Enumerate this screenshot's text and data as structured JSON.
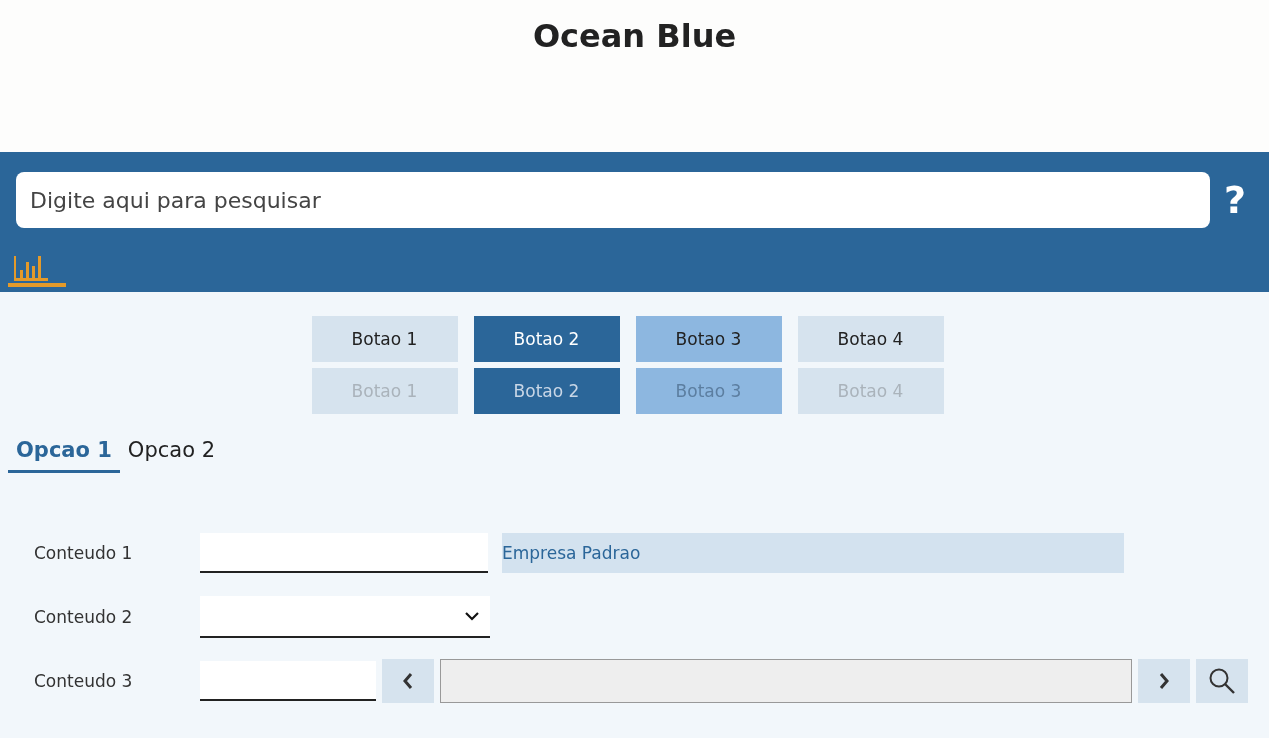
{
  "title": "Ocean Blue",
  "search": {
    "placeholder": "Digite aqui para pesquisar"
  },
  "help": "?",
  "button_rows": [
    [
      {
        "label": "Botao 1",
        "kind": "default",
        "disabled": false
      },
      {
        "label": "Botao 2",
        "kind": "primary",
        "disabled": false
      },
      {
        "label": "Botao 3",
        "kind": "secondary",
        "disabled": false
      },
      {
        "label": "Botao 4",
        "kind": "default",
        "disabled": false
      }
    ],
    [
      {
        "label": "Botao 1",
        "kind": "default",
        "disabled": true
      },
      {
        "label": "Botao 2",
        "kind": "primary",
        "disabled": true
      },
      {
        "label": "Botao 3",
        "kind": "secondary",
        "disabled": true
      },
      {
        "label": "Botao 4",
        "kind": "default",
        "disabled": true
      }
    ]
  ],
  "tabs": [
    {
      "label": "Opcao 1",
      "selected": true
    },
    {
      "label": "Opcao 2",
      "selected": false
    }
  ],
  "form": [
    {
      "kind": "text",
      "label": "Conteudo 1",
      "display": "Empresa Padrao"
    },
    {
      "kind": "select",
      "label": "Conteudo 2"
    },
    {
      "kind": "lookup",
      "label": "Conteudo 3"
    }
  ]
}
